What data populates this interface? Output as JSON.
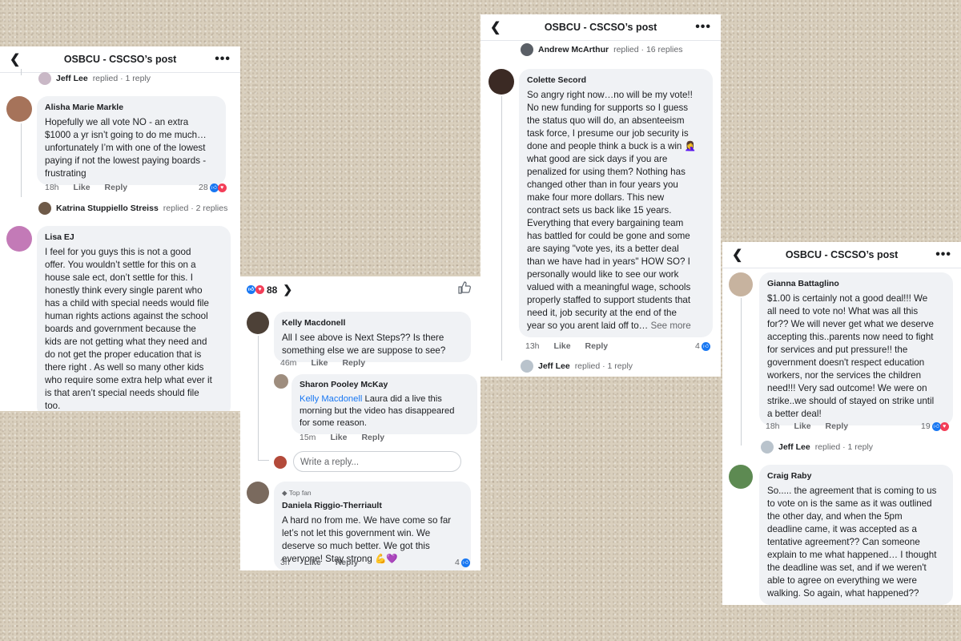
{
  "panel1": {
    "title": "OSBCU - CSCSO’s post",
    "top_reply": {
      "name": "Jeff Lee",
      "text": "replied · 1 reply"
    },
    "c1": {
      "author": "Alisha Marie Markle",
      "lines": [
        "Hopefully we all vote NO - an extra",
        "$1000 a yr isn’t going to do me much…",
        "unfortunately I’m with one of the lowest",
        "paying if not the lowest paying boards -",
        "frustrating"
      ],
      "time": "18h",
      "like": "Like",
      "reply": "Reply",
      "count": "28"
    },
    "c1_reply": {
      "name": "Katrina Stuppiello Streiss",
      "text": "replied · 2 replies"
    },
    "c2": {
      "author": "Lisa EJ",
      "lines": [
        "I feel for you guys this is not a good",
        "offer. You wouldn’t settle for this on a",
        "house sale ect, don’t settle for this. I",
        "honestly think every single parent who",
        "has a child with special needs would file",
        "human rights actions against the school",
        "boards and government because the",
        "kids are not getting what they need and",
        "do not get the proper education that is",
        "there right . As well so many other kids",
        "who require some extra help what ever it",
        "is that aren’t special needs should file",
        "too."
      ]
    }
  },
  "panel2": {
    "reaction_count": "88",
    "c1": {
      "author": "Kelly Macdonell",
      "lines": [
        "All I see above is Next Steps?? Is there",
        "something else we are suppose to see?"
      ],
      "time": "46m",
      "like": "Like",
      "reply": "Reply"
    },
    "c2": {
      "author": "Sharon Pooley McKay",
      "mention": "Kelly Macdonell",
      "lines_first": " Laura did a live this",
      "lines": [
        "morning but the video has disappeared",
        "for some reason."
      ],
      "time": "15m",
      "like": "Like",
      "reply": "Reply"
    },
    "write_reply_placeholder": "Write a reply...",
    "c3": {
      "badge": "Top fan",
      "author": "Daniela Riggio-Therriault",
      "lines": [
        "A hard no from me.  We have come so far",
        "let’s not let this government win.  We",
        "deserve so much better.  We got this",
        "everyone! Stay strong 💪💜"
      ],
      "time": "3h",
      "like": "Like",
      "reply": "Reply",
      "count": "4"
    }
  },
  "panel3": {
    "title": "OSBCU - CSCSO’s post",
    "top_reply": {
      "name": "Andrew McArthur",
      "text": "replied · 16 replies"
    },
    "c1": {
      "author": "Colette Secord",
      "lines": [
        "So angry right now…no will be my vote!!",
        "No new funding for supports so I guess",
        "the status quo will do, an absenteeism",
        "task force, I presume our job security is",
        "done and people think a buck is a win 🤦‍♀️",
        "what good are sick days if you are",
        "penalized for using them? Nothing has",
        "changed other than in four years you",
        "make four more dollars. This new",
        "contract sets us back like 15 years.",
        "Everything that every bargaining team",
        "has battled for could be gone and some",
        "are saying \"vote yes, its a better deal",
        "than we have had in years\" HOW SO? I",
        "personally would like to see our work",
        "valued with a meaningful wage, schools",
        "properly staffed to support students that",
        "need it, job security at the end of the"
      ],
      "last_line": "year so you arent laid off to… ",
      "see_more": "See more",
      "time": "13h",
      "like": "Like",
      "reply": "Reply",
      "count": "4"
    },
    "c1_reply": {
      "name": "Jeff Lee",
      "text": "replied · 1 reply"
    }
  },
  "panel4": {
    "title": "OSBCU - CSCSO’s post",
    "c1": {
      "author": "Gianna Battaglino",
      "lines": [
        "$1.00 is certainly not a good deal!!!  We",
        "all need to vote no! What was all this",
        "for?? We will never get what we deserve",
        "accepting this..parents now need to fight",
        "for services and put pressure!! the",
        "government doesn't respect education",
        "workers,  nor the services the children",
        "need!!! Very sad outcome! We were on",
        "strike..we should of stayed on strike until",
        "a better deal!"
      ],
      "time": "18h",
      "like": "Like",
      "reply": "Reply",
      "count": "19"
    },
    "c1_reply": {
      "name": "Jeff Lee",
      "text": "replied · 1 reply"
    },
    "c2": {
      "author": "Craig Raby",
      "lines": [
        "So..... the agreement that is coming to us",
        "to vote on is the same as it was outlined",
        "the other day, and when the 5pm",
        "deadline came, it was accepted as a",
        "tentative agreement?? Can someone",
        "explain to me what happened… I thought",
        "the deadline was set, and if we weren't",
        "able to agree on everything we were",
        "walking.  So again, what happened??"
      ]
    }
  },
  "colors": {
    "link": "#1877f2",
    "bubble": "#f0f2f5",
    "muted": "#65676b",
    "background": "#d9cfbd"
  }
}
